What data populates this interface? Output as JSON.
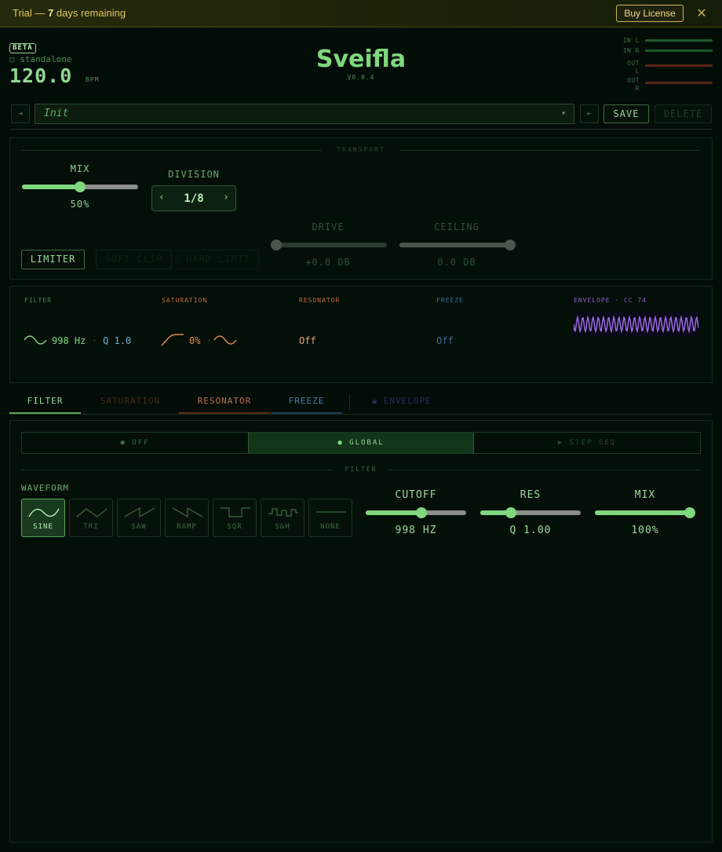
{
  "trial_banner": {
    "prefix": "Trial —",
    "days": "7",
    "suffix": "days remaining",
    "buy_label": "Buy License",
    "close_icon": "close-icon"
  },
  "header": {
    "beta_badge": "BETA",
    "mode_indicator": "○ standalone",
    "bpm_value": "120.0",
    "bpm_label": "BPM",
    "app_title": "Sveifla",
    "version": "V0.8.4",
    "meters": [
      {
        "label": "IN L",
        "color": "#1c5a2a"
      },
      {
        "label": "IN R",
        "color": "#1c5a2a"
      },
      {
        "label": "OUT L",
        "color": "#5a2418"
      },
      {
        "label": "OUT R",
        "color": "#5a2418"
      }
    ]
  },
  "preset_bar": {
    "prev_icon": "◄",
    "next_icon": "►",
    "preset_name": "Init",
    "dropdown_icon": "▾",
    "save_label": "SAVE",
    "delete_label": "DELETE"
  },
  "transport": {
    "section_label": "TRANSPORT",
    "mix_label": "MIX",
    "mix_value": "50%",
    "mix_fraction": 0.5,
    "division_label": "DIVISION",
    "division_value": "1/8",
    "division_prev": "‹",
    "division_next": "›",
    "drive_label": "DRIVE",
    "drive_value": "+0.0 DB",
    "drive_fraction": 0.0,
    "ceiling_label": "CEILING",
    "ceiling_value": "0.0 DB",
    "ceiling_fraction": 1.0,
    "clip_modes": [
      "LIMITER",
      "SOFT CLIP",
      "HARD LIMIT"
    ]
  },
  "modules": {
    "filter": {
      "title": "FILTER",
      "freq": "998 Hz",
      "sep": "·",
      "q": "Q 1.0",
      "color": "#7fd87e"
    },
    "saturation": {
      "title": "SATURATION",
      "amount": "0%",
      "sep": "·",
      "color": "#e08a4a"
    },
    "resonator": {
      "title": "RESONATOR",
      "status": "Off",
      "color": "#e09a6a"
    },
    "freeze": {
      "title": "FREEZE",
      "status": "Off",
      "color": "#3e6a9a"
    },
    "envelope": {
      "title": "ENVELOPE · CC 74",
      "color": "#9a6ae0"
    }
  },
  "tabs": [
    {
      "label": "FILTER",
      "color": "#9bd89b",
      "underline": "#5aa85a"
    },
    {
      "label": "SATURATION",
      "color": "#4a2618",
      "underline": "#3a1a10"
    },
    {
      "label": "RESONATOR",
      "color": "#c0704a",
      "underline": "#5a2a18"
    },
    {
      "label": "FREEZE",
      "color": "#4a7ab0",
      "underline": "#1e3a5e"
    },
    {
      "label": "ENVELOPE",
      "color": "#2f2a5e",
      "underline": "transparent"
    }
  ],
  "filter_page": {
    "modes": [
      {
        "label": "OFF",
        "active": false
      },
      {
        "label": "GLOBAL",
        "active": true
      },
      {
        "label": "STEP SEQ",
        "active": false
      }
    ],
    "section_label": "FILTER",
    "waveform_label": "WAVEFORM",
    "waveforms": [
      "SINE",
      "TRI",
      "SAW",
      "RAMP",
      "SQR",
      "S&H",
      "NONE"
    ],
    "selected_waveform": "SINE",
    "cutoff_label": "CUTOFF",
    "cutoff_value": "998 HZ",
    "cutoff_fraction": 0.56,
    "res_label": "RES",
    "res_value": "Q 1.00",
    "res_fraction": 0.28,
    "mix_label": "MIX",
    "mix_value": "100%",
    "mix_fraction": 1.0
  }
}
